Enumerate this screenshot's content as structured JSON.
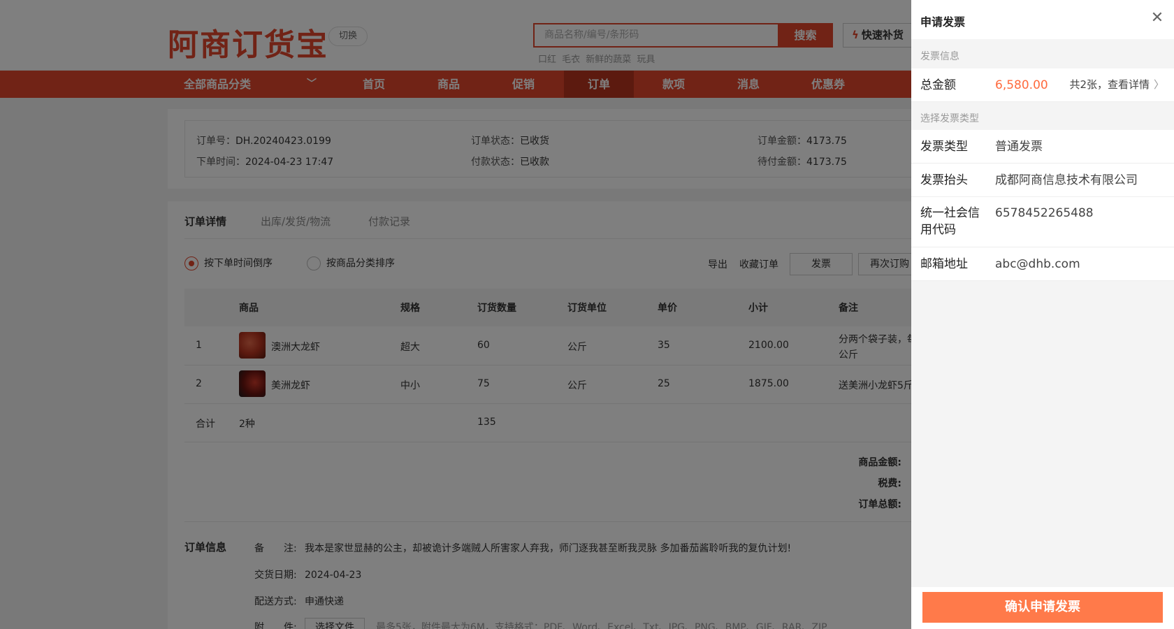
{
  "header": {
    "logo": "阿商订货宝",
    "switch_label": "切换",
    "search_placeholder": "商品名称/编号/条形码",
    "search_button": "搜索",
    "hot_words": "口红 毛衣 新鲜的蔬菜 玩具",
    "quick_button": "快速补货"
  },
  "nav": {
    "category_label": "全部商品分类",
    "items": [
      "首页",
      "商品",
      "促销",
      "订单",
      "款项",
      "消息",
      "优惠券"
    ],
    "active": "订单"
  },
  "order_summary": {
    "order_no_label": "订单号：",
    "order_no": "DH.20240423.0199",
    "order_time_label": "下单时间：",
    "order_time": "2024-04-23 17:47",
    "order_status_label": "订单状态：",
    "order_status": "已收货",
    "pay_status_label": "付款状态：",
    "pay_status": "已收款",
    "order_amount_label": "订单金额：",
    "order_amount": "4173.75",
    "pending_amount_label": "待付金额：",
    "pending_amount": "4173.75"
  },
  "tabs": [
    "订单详情",
    "出库/发货/物流",
    "付款记录"
  ],
  "sort_options": [
    "按下单时间倒序",
    "按商品分类排序"
  ],
  "actions": {
    "export": "导出",
    "favorite": "收藏订单",
    "invoice": "发票",
    "reorder": "再次订购"
  },
  "table": {
    "headers": [
      "商品",
      "规格",
      "订货数量",
      "订货单位",
      "单价",
      "小计",
      "备注"
    ],
    "rows": [
      {
        "no": "1",
        "name": "澳洲大龙虾",
        "spec": "超大",
        "qty": "60",
        "unit": "公斤",
        "price": "35",
        "subtotal": "2100.00",
        "note_line1": "分两个袋子装，每",
        "note_line2": "公斤"
      },
      {
        "no": "2",
        "name": "美洲龙虾",
        "spec": "中小",
        "qty": "75",
        "unit": "公斤",
        "price": "25",
        "subtotal": "1875.00",
        "note_line1": "送美洲小龙虾5斤",
        "note_line2": ""
      }
    ],
    "total": {
      "label": "合计",
      "kinds": "2种",
      "qty": "135"
    }
  },
  "summary_labels": {
    "goods_amount": "商品金额:",
    "tax": "税费:",
    "order_total": "订单总额:"
  },
  "order_info": {
    "title": "订单信息",
    "remark_label": "备　　注:",
    "remark": "我本是家世显赫的公主，却被诡计多端贼人所害家人弃我，师门逐我甚至断我灵脉 多加番茄酱聆听我的复仇计划!",
    "delivery_date_label": "交货日期:",
    "delivery_date": "2024-04-23",
    "delivery_method_label": "配送方式:",
    "delivery_method": "申通快递",
    "attachment_label": "附　　件:",
    "attachment_button": "选择文件",
    "attachment_hint": "最多5张，附件最大为6M，支持格式：PDF、Word、Excel、Txt、JPG、PNG、BMP、GIF、RAR、ZIP"
  },
  "drawer": {
    "title": "申请发票",
    "section_info": "发票信息",
    "total_label": "总金额",
    "total_amount": "6,580.00",
    "detail_link": "共2张，查看详情",
    "section_type": "选择发票类型",
    "fields": [
      {
        "label": "发票类型",
        "value": "普通发票"
      },
      {
        "label": "发票抬头",
        "value": "成都阿商信息技术有限公司"
      },
      {
        "label_line1": "统一社会信",
        "label_line2": "用代码",
        "value": "6578452265488"
      },
      {
        "label": "邮箱地址",
        "value": "abc@dhb.com"
      }
    ],
    "confirm_button": "确认申请发票"
  },
  "colors": {
    "brand": "#e3472d",
    "accent": "#ff6a3d",
    "confirm": "#ff7a4a"
  }
}
